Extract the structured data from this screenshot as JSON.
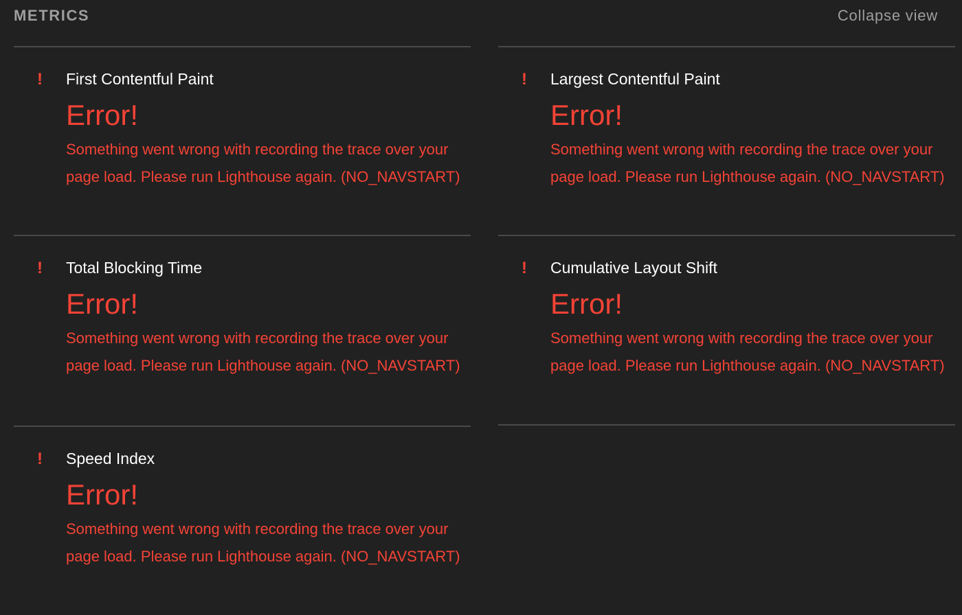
{
  "header": {
    "title": "METRICS",
    "toggle_label": "Collapse view"
  },
  "colors": {
    "background": "#212121",
    "error": "#f44336",
    "muted": "#9e9e9e",
    "divider": "#4a4a4a"
  },
  "metrics": [
    {
      "icon": "exclamation-icon",
      "title": "First Contentful Paint",
      "value": "Error!",
      "description": "Something went wrong with recording the trace over your page load. Please run Lighthouse again. (NO_NAVSTART)"
    },
    {
      "icon": "exclamation-icon",
      "title": "Largest Contentful Paint",
      "value": "Error!",
      "description": "Something went wrong with recording the trace over your page load. Please run Lighthouse again. (NO_NAVSTART)"
    },
    {
      "icon": "exclamation-icon",
      "title": "Total Blocking Time",
      "value": "Error!",
      "description": "Something went wrong with recording the trace over your page load. Please run Lighthouse again. (NO_NAVSTART)"
    },
    {
      "icon": "exclamation-icon",
      "title": "Cumulative Layout Shift",
      "value": "Error!",
      "description": "Something went wrong with recording the trace over your page load. Please run Lighthouse again. (NO_NAVSTART)"
    },
    {
      "icon": "exclamation-icon",
      "title": "Speed Index",
      "value": "Error!",
      "description": "Something went wrong with recording the trace over your page load. Please run Lighthouse again. (NO_NAVSTART)"
    }
  ]
}
